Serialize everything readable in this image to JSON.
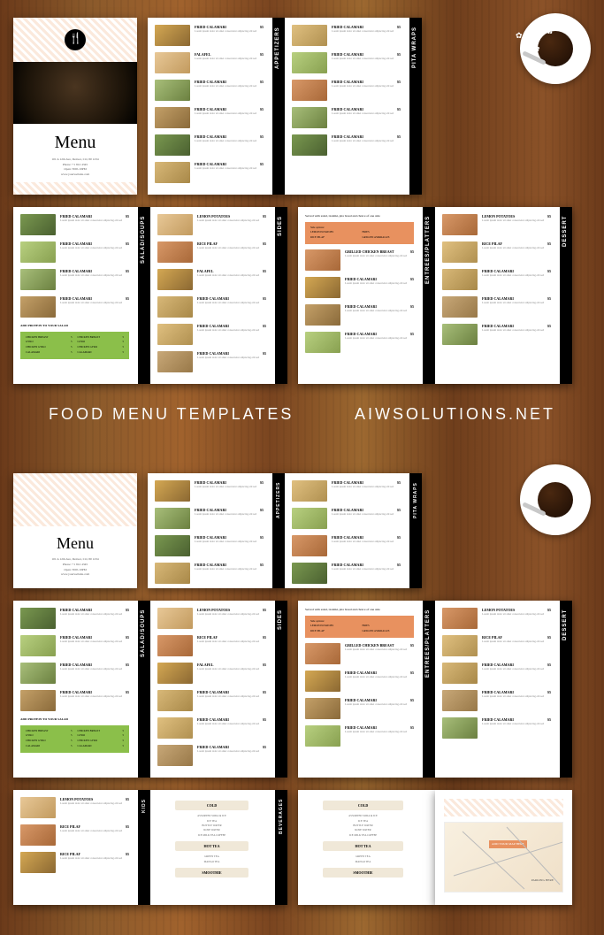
{
  "titles": {
    "left": "FOOD MENU TEMPLATES",
    "right": "AIWSOLUTIONS.NET"
  },
  "cover": {
    "menu": "Menu",
    "address": "101 A 12th Ave, Denver, CO, 80 1234",
    "phone": "Phone: +1 812 4345",
    "hours": "Open: 8:00-10PM",
    "web": "www.yourwebsite.com"
  },
  "tabs": {
    "appetizers": "APPETIZERS",
    "pita": "PITA WRAPS",
    "salad": "SALAD/SOUPS",
    "sides": "SIDES",
    "entrees": "ENTREES/PLATTERS",
    "dessert": "DESSERT",
    "kids": "KIDS",
    "beverages": "BEVERAGES"
  },
  "items": {
    "fried_calamari": "FRIED CALAMARI",
    "falafel": "FALAFEL",
    "lemon_potatoes": "LEMON POTATOES",
    "rice_pilaf": "RICE PILAF",
    "grilled_chicken": "GRILLED CHICKEN BREAST",
    "desc": "Lorem ipsum dolor sit amet consectetur adipiscing elit sed",
    "price": "$5"
  },
  "protein": {
    "title": "ADD PROTEIN TO YOUR SALAD",
    "chicken_breast": "CHICKEN BREAST",
    "gyro": "GYRO",
    "chicken_gyro": "CHICKEN GYRO",
    "calamari": "CALAMARI",
    "p": "5"
  },
  "entree_header": {
    "served": "Served with salad, tzatziki, pita bread and choice of one side",
    "side_options": "Side options:",
    "lemon": "LEMON POTATOES",
    "fries": "FRIES",
    "rice": "RICE PILAF",
    "asparagus": "GRILLED ASPARAGUS"
  },
  "bev": {
    "cold": "COLD",
    "hot_tea": "HOT TEA",
    "smoothie": "SMOOTHIE",
    "i1": "ASSORTED SODA & ICE",
    "i2": "ICE TEA",
    "i3": "BOTTLE WATER",
    "i4": "ROSE WATER",
    "i5": "GREEN TEA",
    "i6": "MANGO TEA",
    "i7": "ICE MILK TEA COFFEE"
  },
  "map": {
    "pin": "ADD YOUR MAP HERE",
    "parking": "PARKING HERE"
  }
}
